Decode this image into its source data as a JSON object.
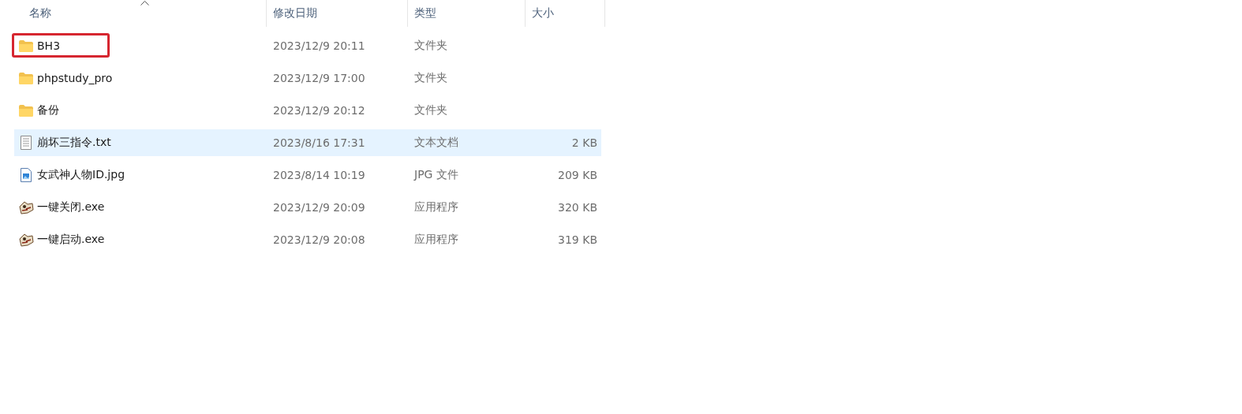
{
  "columns": [
    {
      "label": "名称",
      "sorted": true
    },
    {
      "label": "修改日期",
      "sorted": false
    },
    {
      "label": "类型",
      "sorted": false
    },
    {
      "label": "大小",
      "sorted": false
    }
  ],
  "rows": [
    {
      "kind": "folder",
      "name": "BH3",
      "modified": "2023/12/9 20:11",
      "type": "文件夹",
      "selected": false,
      "annotated": true
    },
    {
      "kind": "folder",
      "name": "phpstudy_pro",
      "modified": "2023/12/9 17:00",
      "type": "文件夹",
      "selected": false,
      "annotated": false
    },
    {
      "kind": "folder",
      "name": "备份",
      "modified": "2023/12/9 20:12",
      "type": "文件夹",
      "selected": false,
      "annotated": false
    },
    {
      "kind": "text",
      "name": "崩坏三指令.txt",
      "modified": "2023/8/16 17:31",
      "type": "文本文档",
      "size": "2 KB",
      "selected": true,
      "annotated": false
    },
    {
      "kind": "image",
      "name": "女武神人物ID.jpg",
      "modified": "2023/8/14 10:19",
      "type": "JPG 文件",
      "size": "209 KB",
      "selected": false,
      "annotated": false
    },
    {
      "kind": "app",
      "name": "一键关闭.exe",
      "modified": "2023/12/9 20:09",
      "type": "应用程序",
      "size": "320 KB",
      "selected": false,
      "annotated": false
    },
    {
      "kind": "app",
      "name": "一键启动.exe",
      "modified": "2023/12/9 20:08",
      "type": "应用程序",
      "size": "319 KB",
      "selected": false,
      "annotated": false
    }
  ]
}
